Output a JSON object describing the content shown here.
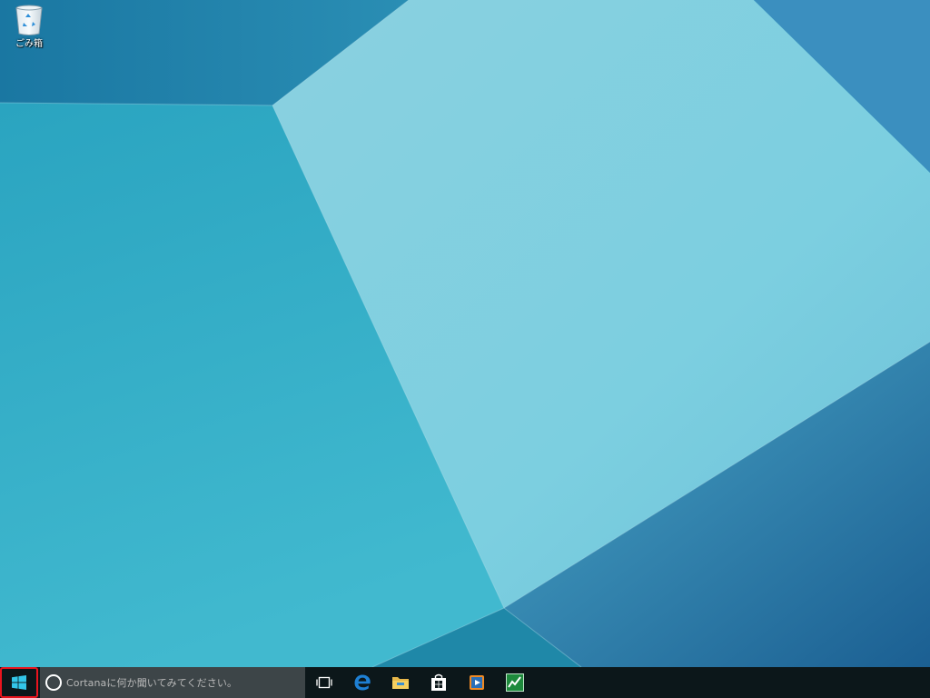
{
  "desktop": {
    "icons": [
      {
        "label": "ごみ箱",
        "icon": "recycle-bin-icon"
      }
    ]
  },
  "taskbar": {
    "start": {
      "icon": "windows-logo-icon"
    },
    "search": {
      "placeholder": "Cortanaに何か聞いてみてください。",
      "icon": "cortana-circle-icon"
    },
    "task_view": {
      "icon": "task-view-icon"
    },
    "pinned": [
      {
        "name": "edge",
        "icon": "edge-icon"
      },
      {
        "name": "file-explorer",
        "icon": "folder-icon"
      },
      {
        "name": "store",
        "icon": "store-bag-icon"
      },
      {
        "name": "media-player",
        "icon": "media-player-icon"
      },
      {
        "name": "activity-monitor",
        "icon": "graph-app-icon"
      }
    ]
  },
  "colors": {
    "taskbar_bg": "#0c171a",
    "search_bg": "#3d4548",
    "highlight": "#e8141e",
    "accent": "#33c5e8"
  }
}
